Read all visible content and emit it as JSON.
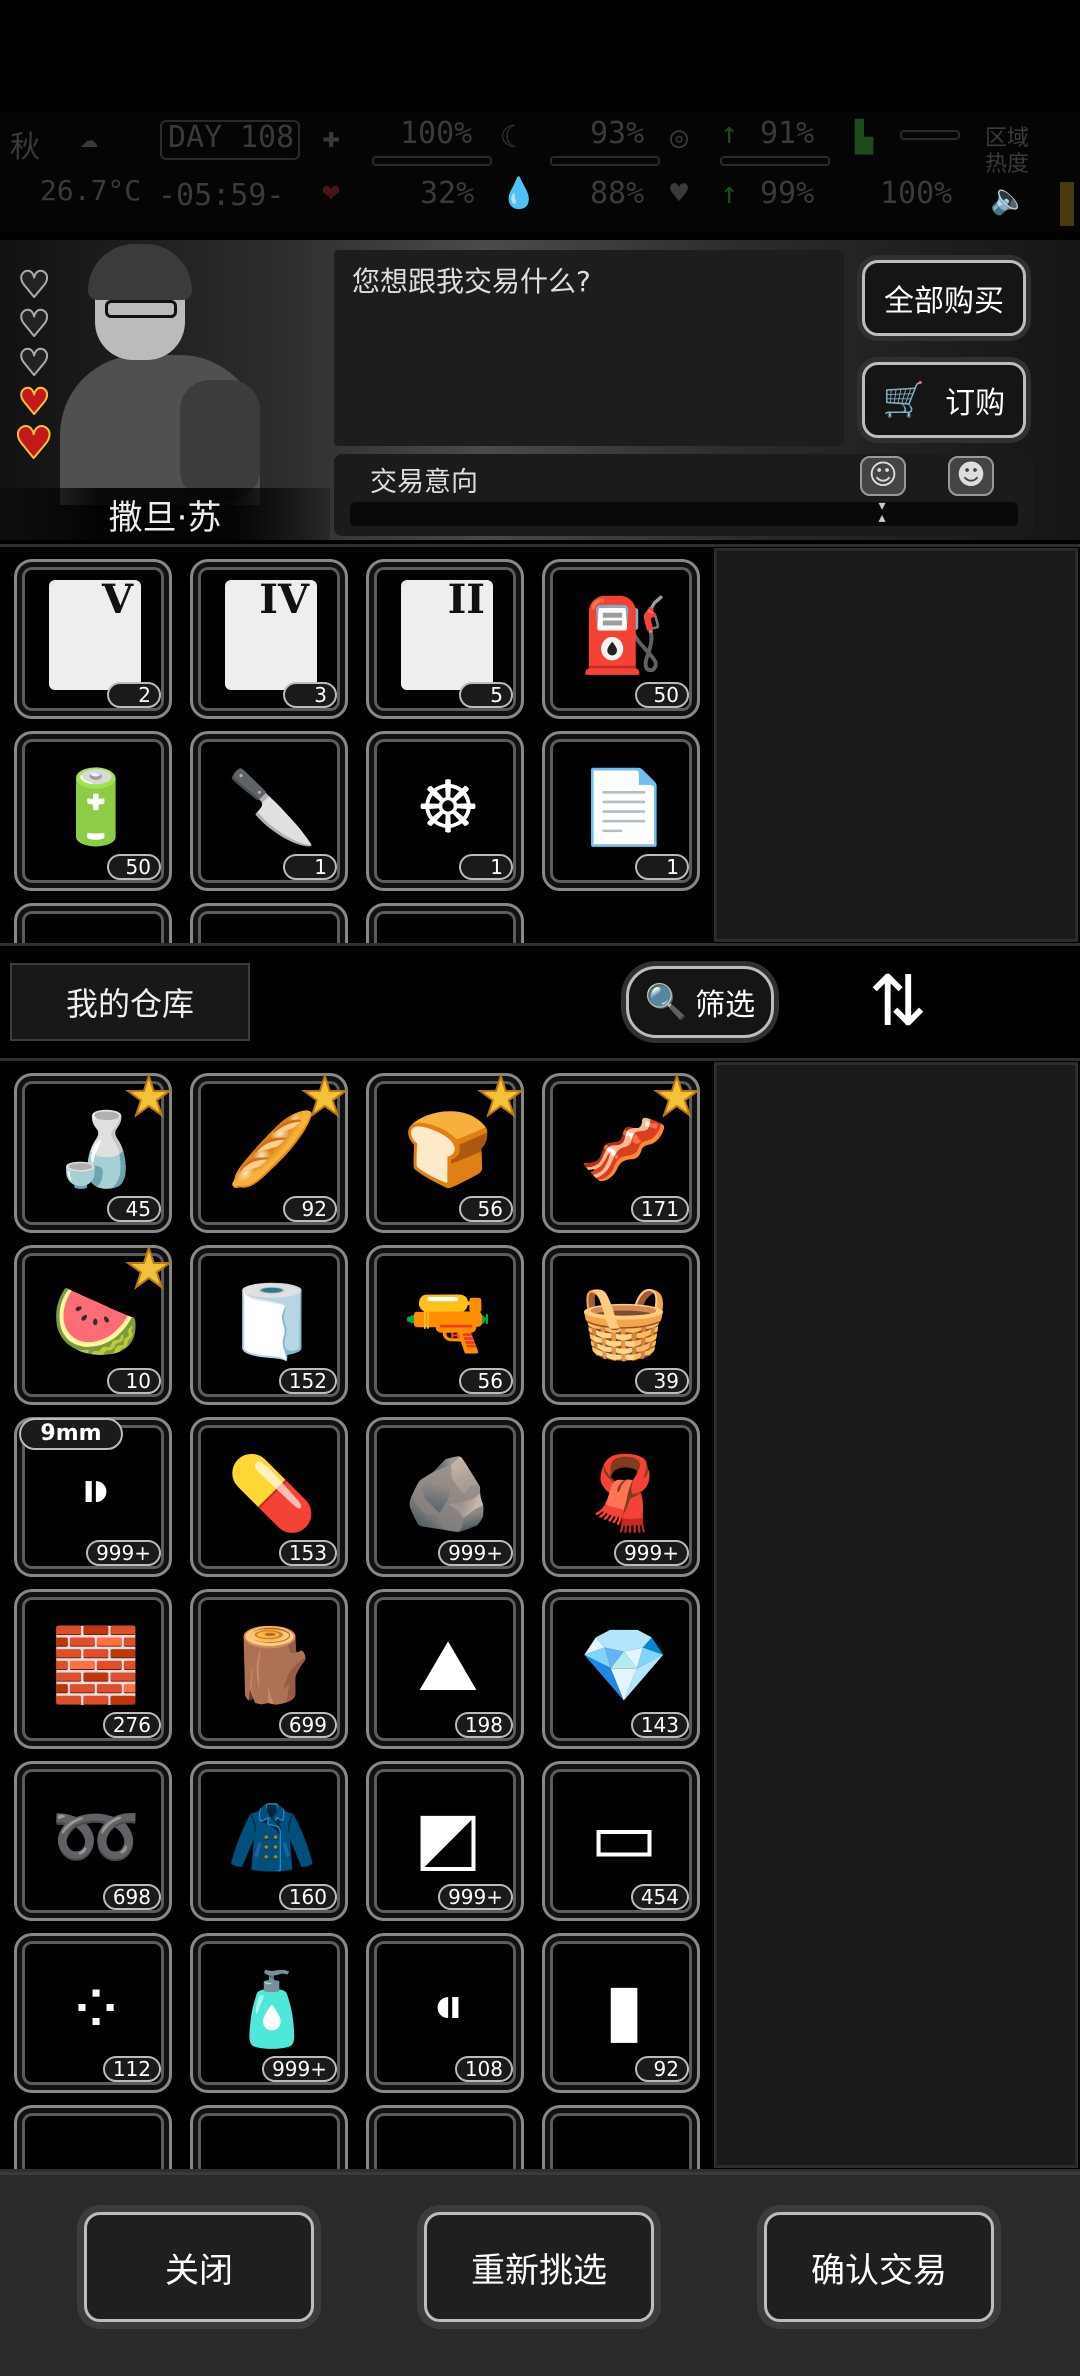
{
  "hud": {
    "season": "秋",
    "temperature": "26.7°C",
    "day_label": "DAY",
    "day_number": "108",
    "time": "-05:59-",
    "stats": [
      "100%",
      "93%",
      "91%",
      "32%",
      "88%",
      "99%",
      "100%"
    ],
    "region_heat_label": "区域热度"
  },
  "npc": {
    "name": "撒旦·苏",
    "hearts_total": 5,
    "hearts_active": 2,
    "dialog": "您想跟我交易什么?"
  },
  "buttons": {
    "buy_all": "全部购买",
    "order": "订购",
    "filter": "筛选",
    "close": "关闭",
    "reselect": "重新挑选",
    "confirm_trade": "确认交易"
  },
  "trade_intent": {
    "label": "交易意向",
    "level": 0.5
  },
  "warehouse_title": "我的仓库",
  "trader_items": [
    {
      "name": "map-v-icon",
      "glyph": "V",
      "count": "2"
    },
    {
      "name": "map-iv-icon",
      "glyph": "IV",
      "count": "3"
    },
    {
      "name": "map-ii-icon",
      "glyph": "II",
      "count": "5"
    },
    {
      "name": "fuel-can-icon",
      "glyph": "⛽",
      "count": "50"
    },
    {
      "name": "battery-icon",
      "glyph": "🔋",
      "count": "50"
    },
    {
      "name": "caliper-knife-icon",
      "glyph": "🔪",
      "count": "1"
    },
    {
      "name": "wheel-blueprint-icon",
      "glyph": "☸",
      "count": "1"
    },
    {
      "name": "repair-manual-icon",
      "glyph": "📄",
      "count": "1"
    }
  ],
  "warehouse_items": [
    {
      "name": "water-bottle-icon",
      "glyph": "🍶",
      "count": "45",
      "star": true
    },
    {
      "name": "baguette-icon",
      "glyph": "🥖",
      "count": "92",
      "star": true
    },
    {
      "name": "bread-icon",
      "glyph": "🍞",
      "count": "56",
      "star": true
    },
    {
      "name": "jerky-icon",
      "glyph": "🥓",
      "count": "171",
      "star": true
    },
    {
      "name": "melon-slice-icon",
      "glyph": "🍉",
      "count": "10",
      "star": true
    },
    {
      "name": "cloth-roll-icon",
      "glyph": "🧻",
      "count": "152",
      "star": false
    },
    {
      "name": "flare-gun-icon",
      "glyph": "🔫",
      "count": "56",
      "star": false
    },
    {
      "name": "towel-icon",
      "glyph": "🧺",
      "count": "39",
      "star": false
    },
    {
      "name": "bullet-9mm-icon",
      "glyph": "⁍",
      "count": "999+",
      "star": false,
      "tag": "9mm"
    },
    {
      "name": "pill-bottle-icon",
      "glyph": "💊",
      "count": "153",
      "star": false
    },
    {
      "name": "ore-icon",
      "glyph": "🪨",
      "count": "999+",
      "star": false
    },
    {
      "name": "fabric-icon",
      "glyph": "🧣",
      "count": "999+",
      "star": false
    },
    {
      "name": "bricks-icon",
      "glyph": "🧱",
      "count": "276",
      "star": false
    },
    {
      "name": "wood-planks-icon",
      "glyph": "🪵",
      "count": "699",
      "star": false
    },
    {
      "name": "salt-pile-icon",
      "glyph": "⛰",
      "count": "198",
      "star": false
    },
    {
      "name": "crystal-icon",
      "glyph": "💎",
      "count": "143",
      "star": false
    },
    {
      "name": "spring-icon",
      "glyph": "➿",
      "count": "698",
      "star": false
    },
    {
      "name": "leather-icon",
      "glyph": "🧥",
      "count": "160",
      "star": false
    },
    {
      "name": "glass-shards-icon",
      "glyph": "◩",
      "count": "999+",
      "star": false
    },
    {
      "name": "board-icon",
      "glyph": "▭",
      "count": "454",
      "star": false
    },
    {
      "name": "beads-icon",
      "glyph": "⁘",
      "count": "112",
      "star": false
    },
    {
      "name": "bottle-icon",
      "glyph": "🧴",
      "count": "999+",
      "star": false
    },
    {
      "name": "bullet-casings-icon",
      "glyph": "⁌",
      "count": "108",
      "star": false
    },
    {
      "name": "tube-cap-icon",
      "glyph": "▮",
      "count": "92",
      "star": false
    }
  ]
}
